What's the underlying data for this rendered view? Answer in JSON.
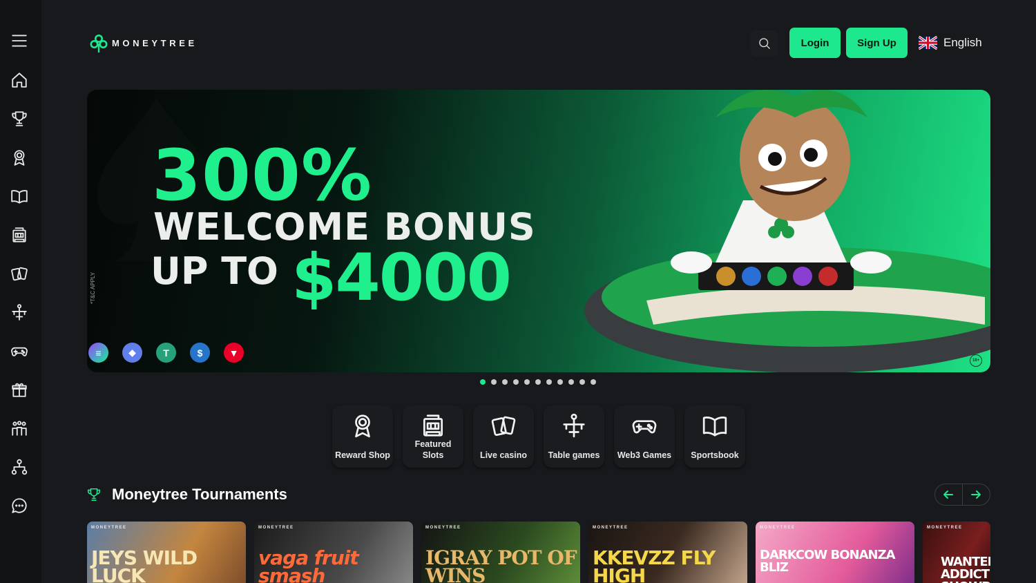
{
  "header": {
    "logo_text": "MONEYTREE",
    "login_label": "Login",
    "signup_label": "Sign Up",
    "language": "English"
  },
  "sidebar": {
    "items": [
      {
        "name": "menu-icon"
      },
      {
        "name": "home-icon"
      },
      {
        "name": "trophy-icon"
      },
      {
        "name": "award-icon"
      },
      {
        "name": "book-icon"
      },
      {
        "name": "slot-machine-icon"
      },
      {
        "name": "cards-icon"
      },
      {
        "name": "table-games-icon"
      },
      {
        "name": "gamepad-icon"
      },
      {
        "name": "gift-icon"
      },
      {
        "name": "community-icon"
      },
      {
        "name": "affiliate-icon"
      },
      {
        "name": "chat-icon"
      }
    ]
  },
  "banner": {
    "line1": "300%",
    "line2": "WELCOME BONUS",
    "line3a": "UP TO",
    "line3b": "$4000",
    "terms": "*T&C APPLY",
    "age_badge": "18+",
    "coins": [
      "solana",
      "ethereum",
      "tether",
      "usd-coin",
      "tron"
    ]
  },
  "carousel": {
    "slide_count": 11,
    "active_index": 0
  },
  "categories": [
    {
      "label": "Reward Shop",
      "icon": "award-icon"
    },
    {
      "label": "Featured Slots",
      "icon": "slot-machine-icon"
    },
    {
      "label": "Live casino",
      "icon": "cards-icon"
    },
    {
      "label": "Table games",
      "icon": "table-games-icon"
    },
    {
      "label": "Web3 Games",
      "icon": "gamepad-icon"
    },
    {
      "label": "Sportsbook",
      "icon": "book-icon"
    }
  ],
  "tournaments": {
    "title": "Moneytree Tournaments",
    "cards": [
      {
        "brand": "MONEYTREE",
        "game": "JEYS WILD LUCK"
      },
      {
        "brand": "MONEYTREE",
        "game": "vaga fruit smash"
      },
      {
        "brand": "MONEYTREE",
        "game": "IGRAY POT OF WINS"
      },
      {
        "brand": "MONEYTREE",
        "game": "KKEVZZ FLY HIGH"
      },
      {
        "brand": "MONEYTREE",
        "game": "DARKCOW BONANZA BLIZ"
      },
      {
        "brand": "MONEYTREE",
        "game": "WANTED: ADDICT SHOWDOWN"
      }
    ]
  },
  "colors": {
    "accent": "#1ee88e",
    "background": "#17191c",
    "sidebar": "#111315"
  }
}
